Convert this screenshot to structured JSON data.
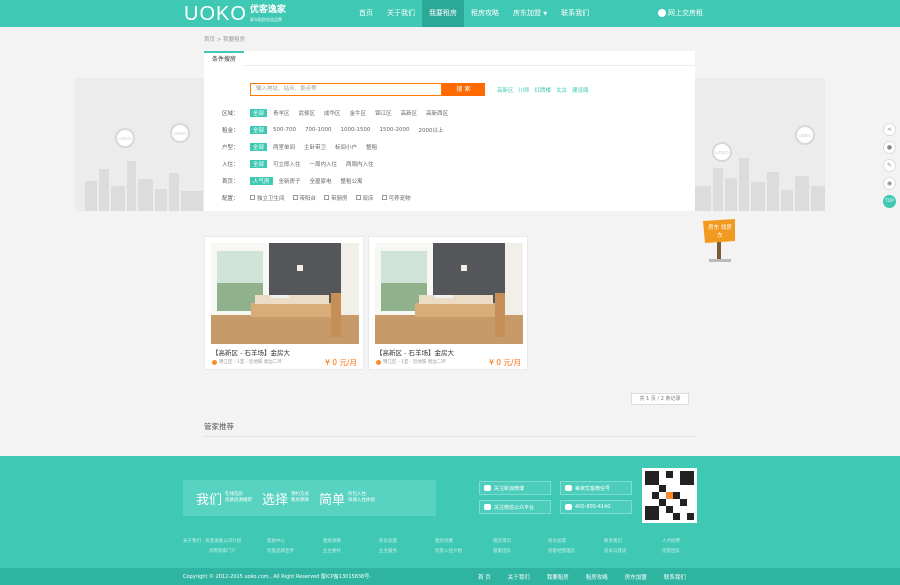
{
  "header": {
    "brand_latin": "UOKO",
    "brand_cn": "优客逸家",
    "brand_sub": "青年租房优选品牌",
    "nav": [
      "首页",
      "关于我们",
      "我要租房",
      "租房攻略",
      "房东加盟",
      "联系我们"
    ],
    "nav_active_index": 2,
    "login": "网上交房租"
  },
  "breadcrumb": "首页 > 我要租房",
  "filter": {
    "tab": "条件搜房",
    "search_placeholder": "输入地址、站点、景点等",
    "search_button": "搜 索",
    "hot": [
      "高新区",
      "川师",
      "红牌楼",
      "太古",
      "建设路"
    ],
    "rows": [
      {
        "label": "区域：",
        "options": [
          "全部",
          "青羊区",
          "武侯区",
          "成华区",
          "金牛区",
          "锦江区",
          "高新区",
          "高新西区"
        ]
      },
      {
        "label": "租金：",
        "options": [
          "全部",
          "500-700",
          "700-1000",
          "1000-1500",
          "1500-2000",
          "2000以上"
        ]
      },
      {
        "label": "户型：",
        "options": [
          "全部",
          "两室单间",
          "主卧带卫",
          "标间小户",
          "整租"
        ]
      },
      {
        "label": "入住：",
        "options": [
          "全部",
          "可立即入住",
          "一周内入住",
          "两周内入住"
        ]
      },
      {
        "label": "首页：",
        "options": [
          "人气房",
          "全新房子",
          "全屋家电",
          "整租公寓"
        ]
      }
    ],
    "config_label": "配置：",
    "config_options": [
      "独立卫生间",
      "带阳台",
      "带厨房",
      "双床",
      "可养宠物"
    ]
  },
  "listings": [
    {
      "title": "【高新区 - 石羊场】金房大",
      "meta": "锦江区 - 1室 - 近地铁 周边二环",
      "price": "¥ 0 元/月"
    },
    {
      "title": "【高新区 - 石羊场】金房大",
      "meta": "锦江区 - 1室 - 近地铁 周边二环",
      "price": "¥ 0 元/月"
    }
  ],
  "pager": "共 1 页 / 2 条记录",
  "recommend_title": "管家推荐",
  "signpost_text": "房东 找房东",
  "banner_badges": [
    "UOKO",
    "UOKO",
    "UOKO",
    "UOKO"
  ],
  "sidebar_icons": [
    "share-icon",
    "qq-icon",
    "edit-icon",
    "wechat-icon",
    "top-icon"
  ],
  "sidebar_top_label": "TOP",
  "footer": {
    "slogan": [
      {
        "big": "我们",
        "small1": "在线选房",
        "small2": "优质房源推荐"
      },
      {
        "big": "选择",
        "small1": "预约方式",
        "small2": "看房保障"
      },
      {
        "big": "简单",
        "small1": "拎包入住",
        "small2": "快速入住体验"
      }
    ],
    "buttons": [
      "关注新浪微博",
      "每家优客微信号",
      "关注微信公众平台",
      "400-800-4140"
    ],
    "link_columns": [
      [
        "关于我们 · 优客逸家公司介绍",
        "优客管家门户"
      ],
      [
        "帮助中心",
        "优客品牌宣传"
      ],
      [
        "租房攻略",
        "业主委托"
      ],
      [
        "房东加盟",
        "业主服务"
      ],
      [
        "租房优惠",
        "优客入住计划"
      ],
      [
        "租房常识",
        "管家团队"
      ],
      [
        "房东加盟",
        "优客经营理念"
      ],
      [
        "联系我们",
        "投诉与建议"
      ],
      [
        "人才招聘",
        "优客团队"
      ]
    ],
    "copyright": "Copyright © 2012-2015 uoko.com , All Right Reserved 蜀ICP备13015838号-",
    "bottom_links": [
      "首 页",
      "关于我们",
      "我要租房",
      "租房攻略",
      "房东加盟",
      "联系我们"
    ]
  },
  "colors": {
    "brand": "#3fc8b4",
    "accent": "#ff6a00"
  }
}
